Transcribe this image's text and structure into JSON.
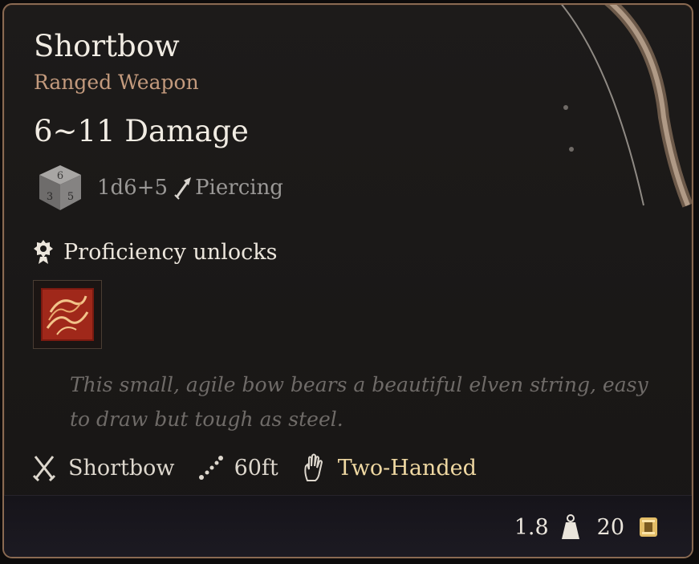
{
  "item": {
    "name": "Shortbow",
    "category": "Ranged Weapon",
    "damage_label": "6~11 Damage",
    "dice_formula": "1d6+5",
    "damage_type": "Piercing",
    "proficiency_label": "Proficiency unlocks",
    "description": "This small, agile bow bears a beautiful elven string, easy to draw but tough as steel.",
    "properties": [
      {
        "icon": "crossed-swords-icon",
        "label": "Shortbow"
      },
      {
        "icon": "range-icon",
        "label": "60ft"
      },
      {
        "icon": "hand-icon",
        "label": "Two-Handed"
      }
    ],
    "weight": "1.8",
    "gold_value": "20"
  },
  "colors": {
    "border": "#8a6a52",
    "title": "#f1ece3",
    "subtitle": "#c39a7d",
    "muted": "#9a9896",
    "description": "#6f6b68",
    "highlight": "#efd8a2",
    "skill_red": "#c0351c"
  },
  "icons": {
    "dice": "d6-dice-icon",
    "damage_type": "arrow-piercing-icon",
    "proficiency": "proficiency-medal-icon",
    "skill": "flame-claw-skill-icon",
    "weight": "weight-icon",
    "coin": "gold-coin-icon"
  }
}
